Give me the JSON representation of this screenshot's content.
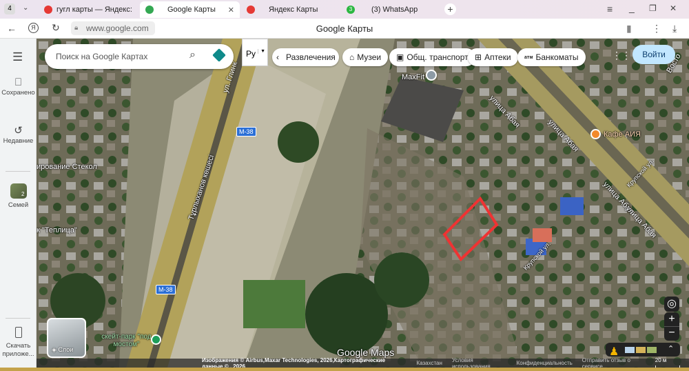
{
  "browser": {
    "tab_count": "4",
    "tabs": [
      {
        "label": "гугл карты — Яндекс: наш",
        "favicon_color": "#e53935"
      },
      {
        "label": "Google Карты",
        "favicon_color": "#34a853"
      },
      {
        "label": "Яндекс Карты",
        "favicon_color": "#e53935"
      },
      {
        "label": "(3) WhatsApp",
        "favicon_color": "#2bb741",
        "badge": "3"
      }
    ],
    "url": "www.google.com",
    "page_title": "Google Карты"
  },
  "sidebar": {
    "items": [
      {
        "label": "Сохранено",
        "icon": "bookmark-icon"
      },
      {
        "label": "Недавние",
        "icon": "history-icon"
      },
      {
        "label": "Семей",
        "icon": "place-thumbnail",
        "badge": "2"
      },
      {
        "label": "Скачать приложе...",
        "icon": "phone-icon"
      }
    ]
  },
  "search": {
    "placeholder": "Поиск на Google Картах"
  },
  "language_select": "Ру",
  "chips": [
    "Развлечения",
    "Музеи",
    "Общ. транспорт",
    "Аптеки",
    "Банкоматы"
  ],
  "atm_prefix": "атм",
  "signin": "Войти",
  "layers_label": "Слои",
  "map_labels": {
    "maxfit": "MaxFit",
    "cafe": "Кафе АИЯ",
    "abaya": "улица Абая",
    "krupskoy": "Крупской ул.",
    "turlykhanov": "Тұрлыханов көшесі",
    "glinka": "ул. Глинк",
    "m38": "М-38",
    "skatepark": "скейт-парк \"под мостом\"",
    "steklo": "ирование Стекол",
    "teplica": "к \"Теплица\"",
    "vostok": "Восто"
  },
  "watermark": "Google Maps",
  "footer": {
    "attribution": "Изображения © Airbus,Maxar Technologies, 2026,Картографические данные © , 2026",
    "country": "Казахстан",
    "terms": "Условия использования",
    "privacy": "Конфиденциальность",
    "feedback": "Отправить отзыв о сервисе",
    "scale": "20 м"
  }
}
